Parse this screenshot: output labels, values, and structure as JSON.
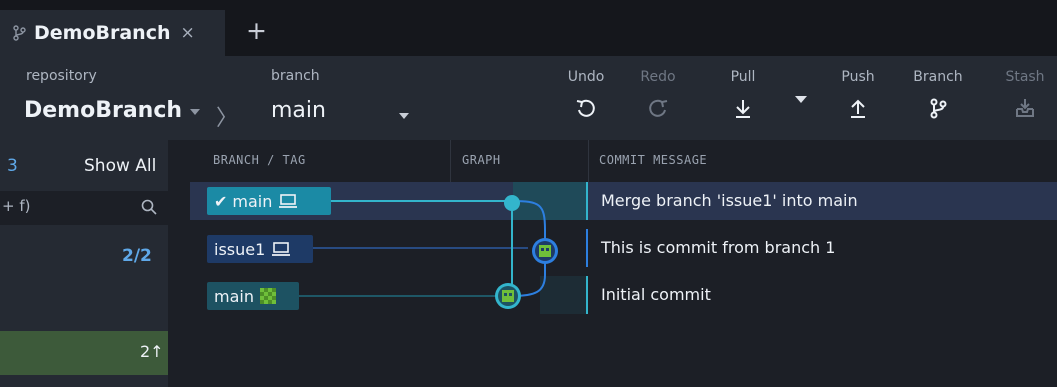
{
  "tab": {
    "title": "DemoBranch",
    "close": "×",
    "add": "+"
  },
  "toolbar": {
    "repository_label": "repository",
    "repository_name": "DemoBranch",
    "branch_label": "branch",
    "branch_name": "main",
    "undo": "Undo",
    "redo": "Redo",
    "pull": "Pull",
    "push": "Push",
    "branch": "Branch",
    "stash": "Stash"
  },
  "sidebar": {
    "count": "3",
    "show_all": "Show All",
    "search_placeholder": "+ f)",
    "fraction": "2/2",
    "ahead": "2↑"
  },
  "graph": {
    "columns": {
      "branch_tag": "BRANCH / TAG",
      "graph": "GRAPH",
      "commit_message": "COMMIT MESSAGE"
    },
    "rows": [
      {
        "branch": "main",
        "checked": true,
        "message": "Merge branch 'issue1' into main"
      },
      {
        "branch": "issue1",
        "message": "This is commit from branch 1"
      },
      {
        "branch": "main",
        "message": "Initial commit"
      }
    ]
  },
  "colors": {
    "accent": "#1b8aa5",
    "selected_row": "#2a3550",
    "lane_main": "#33b5cc",
    "lane_issue": "#2d7fe0"
  }
}
